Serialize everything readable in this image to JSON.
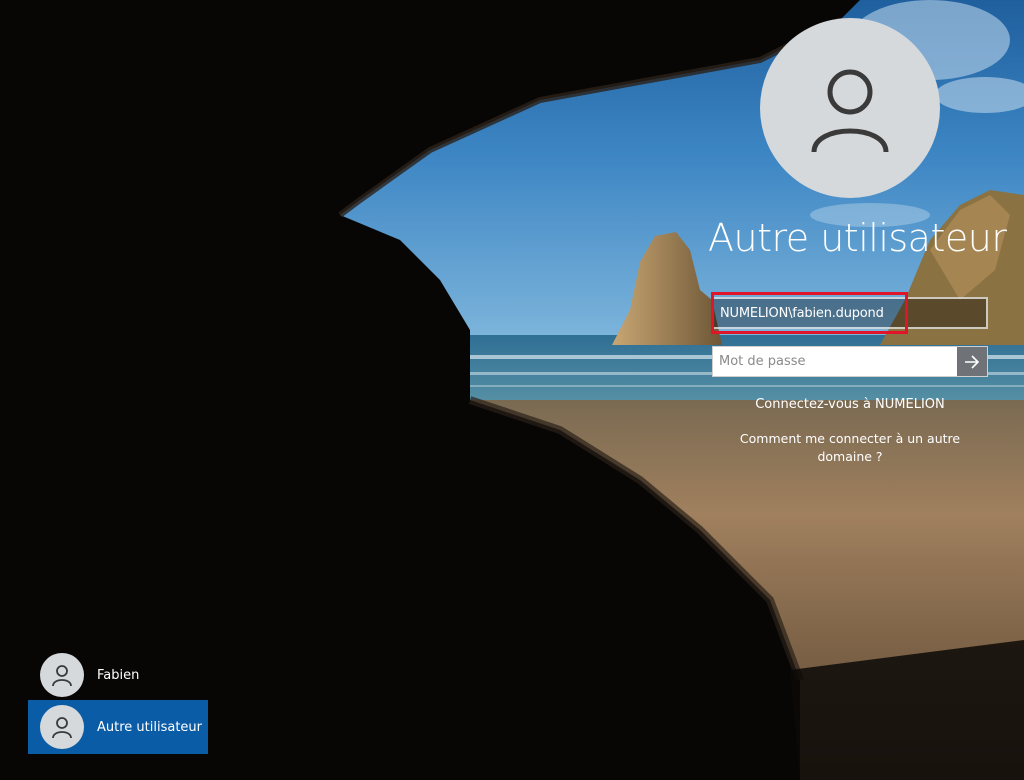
{
  "login": {
    "avatar_icon": "user-avatar-icon",
    "username_title": "Autre utilisateur",
    "username_field_value": "NUMELION\\fabien.dupond",
    "password_placeholder": "Mot de passe",
    "submit_icon": "arrow-right-icon",
    "sign_in_domain_link": "Connectez-vous à NUMELION",
    "other_domain_link_line1": "Comment me connecter à un autre",
    "other_domain_link_line2": "domaine ?",
    "highlight_color": "#e0152a"
  },
  "user_list": {
    "items": [
      {
        "label": "Fabien",
        "icon": "user-avatar-icon",
        "selected": false
      },
      {
        "label": "Autre utilisateur",
        "icon": "user-avatar-icon",
        "selected": true
      }
    ],
    "selected_color": "#0b5ca7"
  }
}
